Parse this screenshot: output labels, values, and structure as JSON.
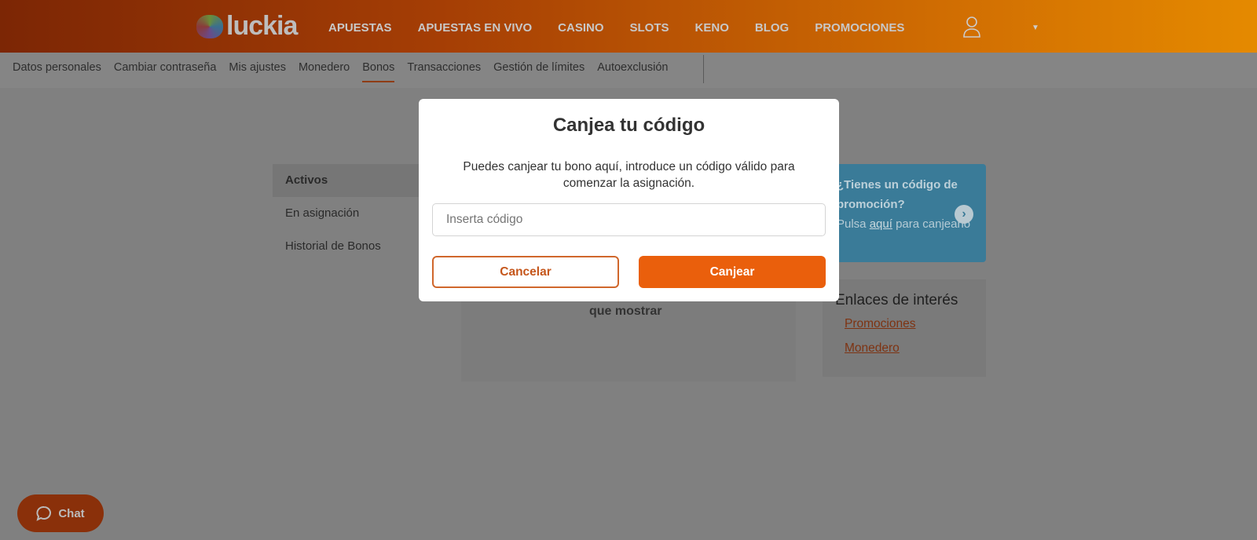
{
  "header": {
    "logo": "luckia",
    "nav": [
      "APUESTAS",
      "APUESTAS EN VIVO",
      "CASINO",
      "SLOTS",
      "KENO",
      "BLOG",
      "PROMOCIONES"
    ]
  },
  "subnav": [
    "Datos personales",
    "Cambiar contraseña",
    "Mis ajustes",
    "Monedero",
    "Bonos",
    "Transacciones",
    "Gestión de límites",
    "Autoexclusión"
  ],
  "sidebar": [
    "Activos",
    "En asignación",
    "Historial de Bonos"
  ],
  "empty_text": "que mostrar",
  "promo": {
    "title": "¿Tienes un código de promoción?",
    "pre": "Pulsa ",
    "link": "aquí",
    "post": " para canjearlo"
  },
  "links": {
    "title": "Enlaces de interés",
    "items": [
      "Promociones",
      "Monedero"
    ]
  },
  "modal": {
    "title": "Canjea tu código",
    "text": "Puedes canjear tu bono aquí, introduce un código válido para comenzar la asignación.",
    "placeholder": "Inserta código",
    "cancel": "Cancelar",
    "submit": "Canjear"
  },
  "chat": "Chat",
  "colors": {
    "accent": "#ea5f0c",
    "promo": "#3a7b98"
  }
}
